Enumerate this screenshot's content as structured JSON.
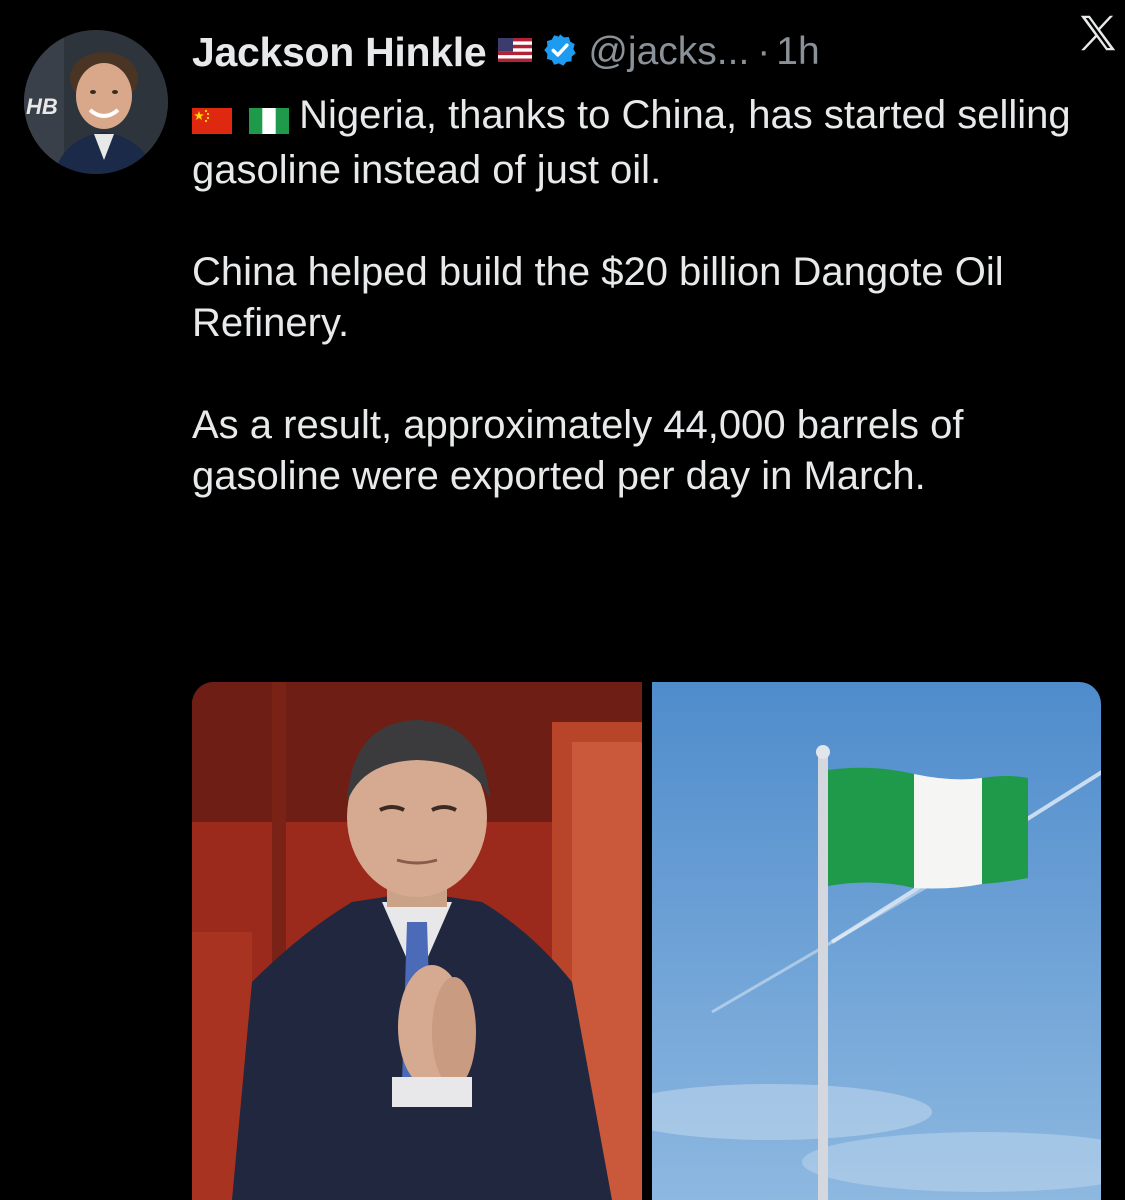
{
  "author": {
    "display_name": "Jackson Hinkle",
    "handle": "@jacks...",
    "separator": "·",
    "time": "1h",
    "verified": true,
    "name_flag": "us-flag-icon"
  },
  "avatar": {
    "logo_text": "HB"
  },
  "tweet": {
    "line1_flags": [
      "china-flag-icon",
      "nigeria-flag-icon"
    ],
    "line1": "Nigeria, thanks to China, has started selling gasoline instead of just oil.",
    "paragraph2": "China helped build the $20 billion Dangote Oil Refinery.",
    "paragraph3": "As a result, approximately 44,000 barrels of gasoline were exported per day in March."
  },
  "media": {
    "images": [
      "photo-man-clapping",
      "photo-nigerian-flag"
    ]
  },
  "colors": {
    "background": "#000000",
    "text": "#e7e9ea",
    "muted": "#8b9198",
    "verified_blue": "#1d9bf0",
    "nigeria_green": "#1f9a4a",
    "china_red": "#de2910",
    "sky_blue": "#5f9bd1"
  }
}
